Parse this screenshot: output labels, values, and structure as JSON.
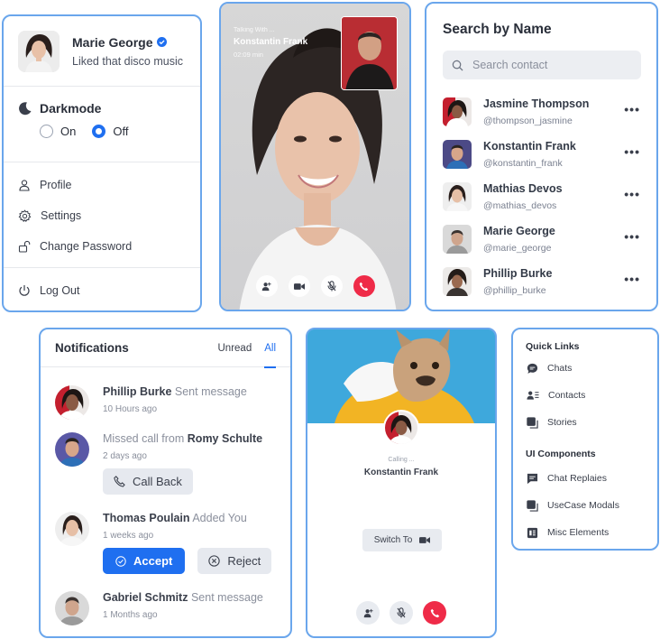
{
  "profile": {
    "name": "Marie George",
    "status": "Liked that disco music",
    "darkmode_label": "Darkmode",
    "darkmode_on": "On",
    "darkmode_off": "Off",
    "darkmode_selected": "Off",
    "menu": [
      {
        "label": "Profile",
        "icon": "user-icon"
      },
      {
        "label": "Settings",
        "icon": "gear-icon"
      },
      {
        "label": "Change Password",
        "icon": "lock-icon"
      }
    ],
    "logout": "Log Out"
  },
  "video_call": {
    "talking_with": "Talking With ...",
    "name": "Konstantin Frank",
    "duration": "02:09 min"
  },
  "search": {
    "title": "Search by Name",
    "placeholder": "Search contact",
    "contacts": [
      {
        "name": "Jasmine Thompson",
        "username": "@thompson_jasmine"
      },
      {
        "name": "Konstantin Frank",
        "username": "@konstantin_frank"
      },
      {
        "name": "Mathias Devos",
        "username": "@mathias_devos"
      },
      {
        "name": "Marie George",
        "username": "@marie_george"
      },
      {
        "name": "Phillip Burke",
        "username": "@phillip_burke"
      }
    ]
  },
  "notifications": {
    "title": "Notifications",
    "tabs": [
      "Unread",
      "All"
    ],
    "active_tab": "All",
    "items": [
      {
        "name": "Phillip Burke",
        "action": "Sent message",
        "time": "10 Hours ago"
      },
      {
        "prefix": "Missed call from",
        "name": "Romy Schulte",
        "time": "2 days ago",
        "button": "Call Back"
      },
      {
        "name": "Thomas Poulain",
        "action": "Added You",
        "time": "1 weeks ago",
        "accept": "Accept",
        "reject": "Reject"
      },
      {
        "name": "Gabriel Schmitz",
        "action": "Sent message",
        "time": "1 Months ago"
      }
    ]
  },
  "calling": {
    "status": "Calling ...",
    "name": "Konstantin Frank",
    "switch": "Switch To"
  },
  "quick_links": {
    "title": "Quick Links",
    "items": [
      "Chats",
      "Contacts",
      "Stories"
    ],
    "ui_title": "UI Components",
    "ui_items": [
      "Chat Replaies",
      "UseCase Modals",
      "Misc Elements"
    ]
  },
  "colors": {
    "accent": "#1f6ff0",
    "border": "#6aa6ec",
    "danger": "#ef2b48"
  }
}
